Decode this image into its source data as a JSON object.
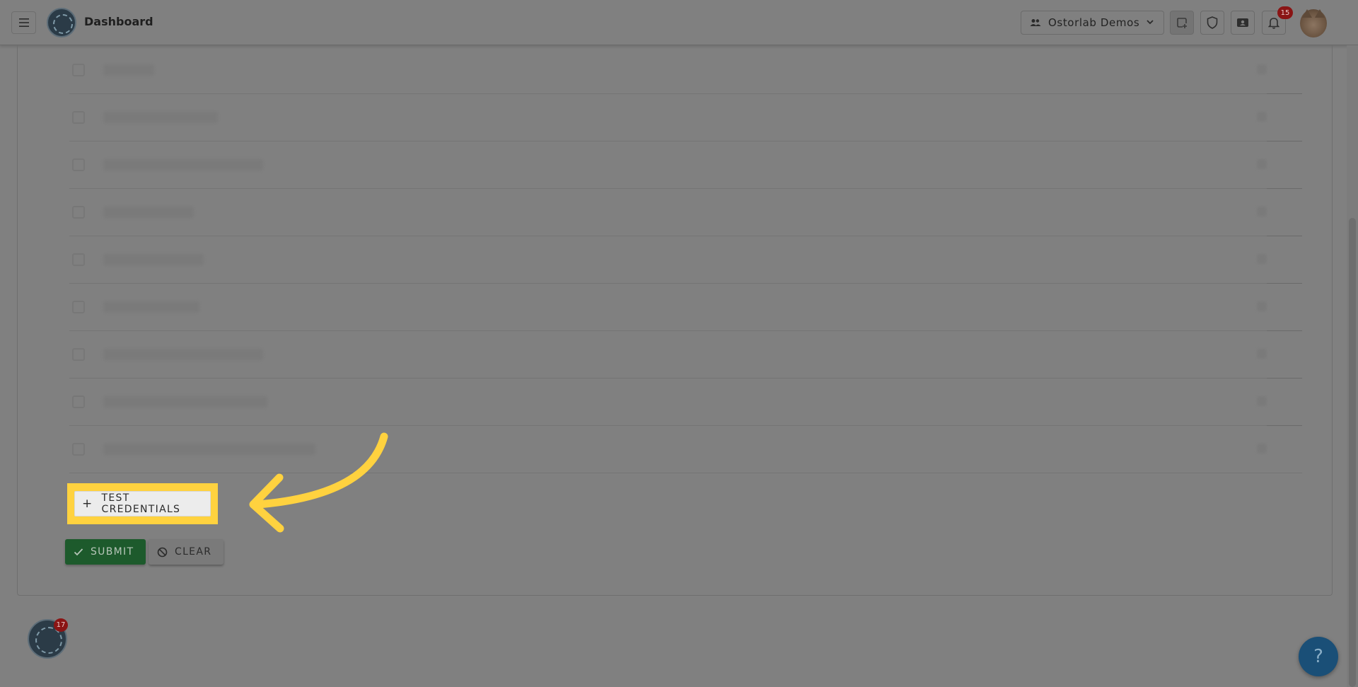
{
  "header": {
    "title": "Dashboard",
    "organization": "Ostorlab Demos",
    "notifications_count": "15"
  },
  "form": {
    "add_credentials_label": "TEST CREDENTIALS",
    "submit_label": "SUBMIT",
    "clear_label": "CLEAR"
  },
  "widget": {
    "badge_count": "17"
  },
  "help": {
    "label": "?"
  },
  "colors": {
    "highlight": "#ffd23f",
    "submit": "#1d5a2c",
    "help": "#1a4f77"
  }
}
